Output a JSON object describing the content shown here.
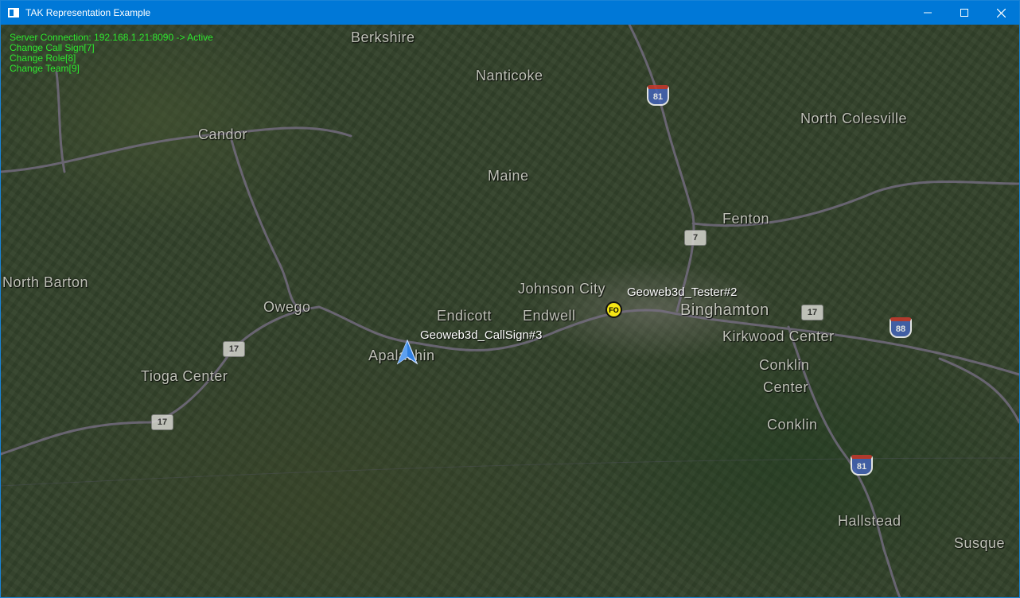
{
  "window": {
    "title": "TAK Representation Example"
  },
  "hud": {
    "server_connection": "Server Connection: 192.168.1.21:8090 -> Active",
    "change_call_sign": "Change Call Sign[7]",
    "change_role": "Change Role[8]",
    "change_team": "Change Team[9]",
    "text_color": "#2ee62e"
  },
  "map": {
    "places": [
      {
        "name": "Berkshire"
      },
      {
        "name": "Nanticoke"
      },
      {
        "name": "North Colesville"
      },
      {
        "name": "Candor"
      },
      {
        "name": "Maine"
      },
      {
        "name": "Fenton"
      },
      {
        "name": "North Barton"
      },
      {
        "name": "Owego"
      },
      {
        "name": "Johnson City"
      },
      {
        "name": "Endicott"
      },
      {
        "name": "Endwell"
      },
      {
        "name": "Binghamton"
      },
      {
        "name": "Kirkwood Center"
      },
      {
        "name": "Apalachin"
      },
      {
        "name": "Tioga Center"
      },
      {
        "name": "Conklin"
      },
      {
        "name": "Center"
      },
      {
        "name": "Conklin"
      },
      {
        "name": "Hallstead"
      },
      {
        "name": "Susque"
      }
    ],
    "shields": {
      "i81_top": "81",
      "route_7": "7",
      "route_17_east": "17",
      "i88": "88",
      "route_17_west": "17",
      "route_17_sw": "17",
      "i81_south": "81"
    }
  },
  "markers": {
    "tester": {
      "label": "Geoweb3d_Tester#2",
      "icon_text": "FO",
      "color": "#f5e615"
    },
    "callsign": {
      "label": "Geoweb3d_CallSign#3",
      "color": "#2f7fe0"
    }
  }
}
